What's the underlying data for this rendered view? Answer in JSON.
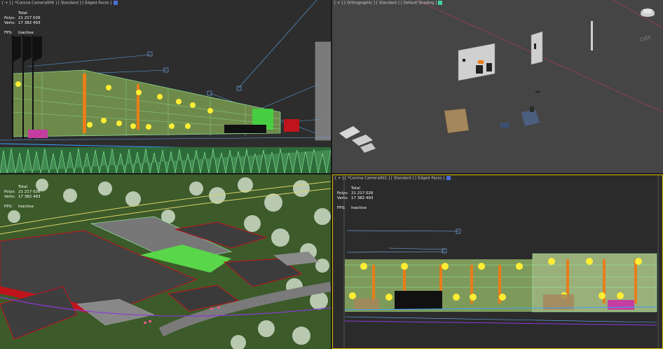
{
  "viewports": {
    "top_left": {
      "label": "[ + ] [ *Corona Camera006 ] [ Standard ] [ Edged Faces ]",
      "square_color": "#4b6fd6",
      "stats": {
        "title": "Total",
        "polys_label": "Polys:",
        "polys": "21 217 026",
        "verts_label": "Verts:",
        "verts": "17 382 493",
        "fps_label": "FPS:",
        "fps": "Inactive"
      }
    },
    "top_right": {
      "label": "[ + ] [ Orthographic ] [ Standard ] [ Default Shading ]",
      "square_color": "#3fd0a8"
    },
    "bottom_left": {
      "stats": {
        "title": "Total",
        "polys_label": "Polys:",
        "polys": "21 217 026",
        "verts_label": "Verts:",
        "verts": "17 382 493",
        "fps_label": "FPS:",
        "fps": "Inactive"
      }
    },
    "bottom_right": {
      "label": "[ + ] [ *Corona Camera001 ] [ Standard ] [ Edged Faces ]",
      "square_color": "#4b6fd6",
      "stats": {
        "title": "Total",
        "polys_label": "Polys:",
        "polys": "21 217 026",
        "verts_label": "Verts:",
        "verts": "17 382 493",
        "fps_label": "FPS:",
        "fps": "Inactive"
      }
    }
  },
  "colors": {
    "active_border": "#e6c200",
    "wire_green": "#9dffb0",
    "lamp_yellow": "#ffee33",
    "roof_red": "#c0141c"
  }
}
